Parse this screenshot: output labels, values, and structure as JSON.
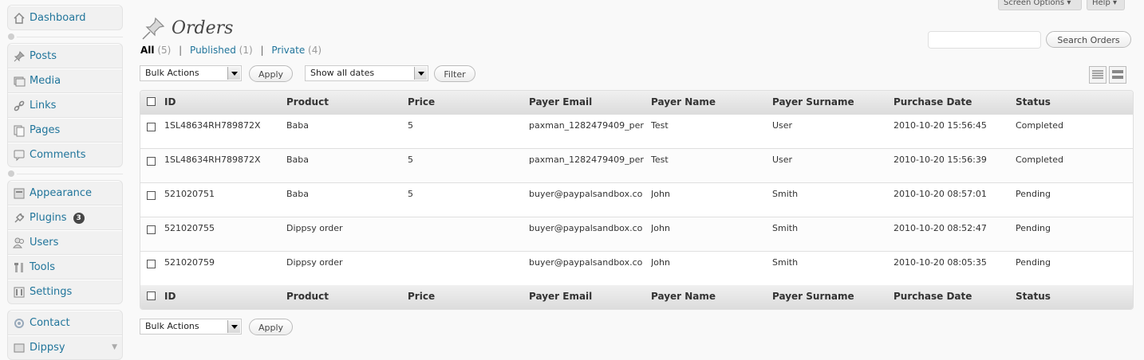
{
  "sidebar": {
    "groups": [
      [
        {
          "label": "Dashboard",
          "icon": "dashboard-icon"
        }
      ],
      [
        {
          "label": "Posts",
          "icon": "pushpin-icon"
        },
        {
          "label": "Media",
          "icon": "media-icon"
        },
        {
          "label": "Links",
          "icon": "link-icon"
        },
        {
          "label": "Pages",
          "icon": "pages-icon"
        },
        {
          "label": "Comments",
          "icon": "comments-icon"
        }
      ],
      [
        {
          "label": "Appearance",
          "icon": "appearance-icon"
        },
        {
          "label": "Plugins",
          "icon": "plugins-icon",
          "badge": "3"
        },
        {
          "label": "Users",
          "icon": "users-icon"
        },
        {
          "label": "Tools",
          "icon": "tools-icon"
        },
        {
          "label": "Settings",
          "icon": "settings-icon"
        }
      ],
      [
        {
          "label": "Contact",
          "icon": "contact-icon"
        },
        {
          "label": "Dippsy",
          "icon": "dippsy-icon"
        }
      ]
    ]
  },
  "header": {
    "title": "Orders",
    "screen_options": "Screen Options",
    "help": "Help"
  },
  "filters": {
    "all_label": "All",
    "all_count": "(5)",
    "published_label": "Published",
    "published_count": "(1)",
    "private_label": "Private",
    "private_count": "(4)"
  },
  "search": {
    "placeholder": "",
    "button": "Search Orders"
  },
  "toolbar": {
    "bulk_actions": "Bulk Actions",
    "apply": "Apply",
    "dates": "Show all dates",
    "filter": "Filter"
  },
  "table": {
    "columns": [
      "ID",
      "Product",
      "Price",
      "Payer Email",
      "Payer Name",
      "Payer Surname",
      "Purchase Date",
      "Status"
    ],
    "rows": [
      {
        "id": "1SL48634RH789872X",
        "product": "Baba",
        "price": "5",
        "email": "paxman_1282479409_per",
        "name": "Test",
        "surname": "User",
        "date": "2010-10-20 15:56:45",
        "status": "Completed"
      },
      {
        "id": "1SL48634RH789872X",
        "product": "Baba",
        "price": "5",
        "email": "paxman_1282479409_per",
        "name": "Test",
        "surname": "User",
        "date": "2010-10-20 15:56:39",
        "status": "Completed"
      },
      {
        "id": "521020751",
        "product": "Baba",
        "price": "5",
        "email": "buyer@paypalsandbox.co",
        "name": "John",
        "surname": "Smith",
        "date": "2010-10-20 08:57:01",
        "status": "Pending"
      },
      {
        "id": "521020755",
        "product": "Dippsy order",
        "price": "",
        "email": "buyer@paypalsandbox.co",
        "name": "John",
        "surname": "Smith",
        "date": "2010-10-20 08:52:47",
        "status": "Pending"
      },
      {
        "id": "521020759",
        "product": "Dippsy order",
        "price": "",
        "email": "buyer@paypalsandbox.co",
        "name": "John",
        "surname": "Smith",
        "date": "2010-10-20 08:05:35",
        "status": "Pending"
      }
    ]
  },
  "bottom_toolbar": {
    "bulk_actions": "Bulk Actions",
    "apply": "Apply"
  }
}
